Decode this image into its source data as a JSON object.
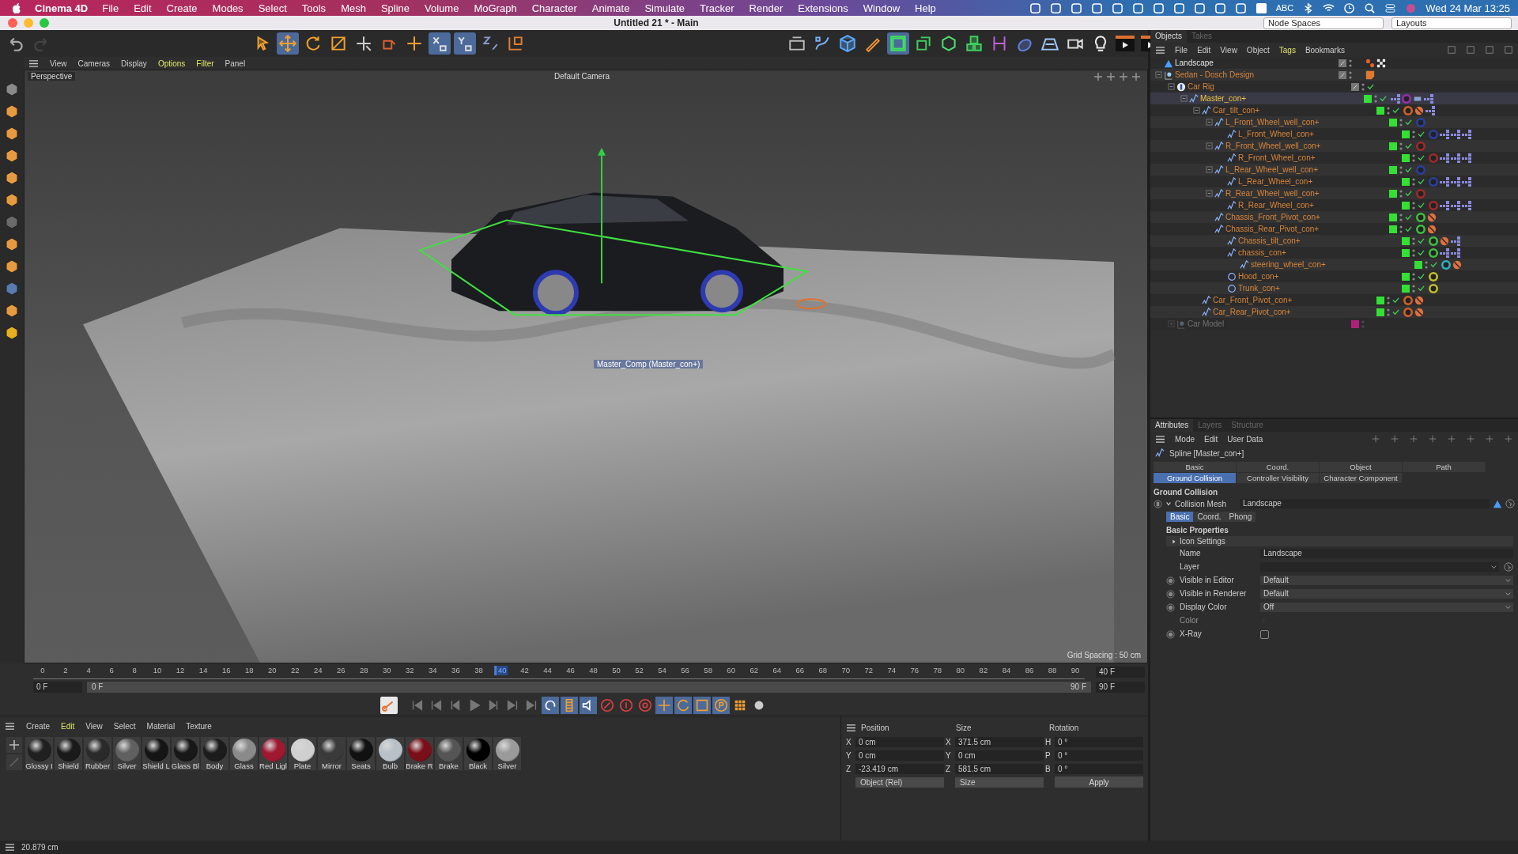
{
  "menubar": {
    "app": "Cinema 4D",
    "items": [
      "File",
      "Edit",
      "Create",
      "Modes",
      "Select",
      "Tools",
      "Mesh",
      "Spline",
      "Volume",
      "MoGraph",
      "Character",
      "Animate",
      "Simulate",
      "Tracker",
      "Render",
      "Extensions",
      "Window",
      "Help"
    ],
    "input_source": "ABC",
    "clock": "Wed 24 Mar  13:25"
  },
  "window": {
    "title": "Untitled 21 * - Main",
    "node_spaces": "Node Spaces",
    "layouts": "Layouts"
  },
  "viewport": {
    "menu": [
      {
        "label": "View",
        "highlighted": false
      },
      {
        "label": "Cameras",
        "highlighted": false
      },
      {
        "label": "Display",
        "highlighted": false
      },
      {
        "label": "Options",
        "highlighted": true
      },
      {
        "label": "Filter",
        "highlighted": true
      },
      {
        "label": "Panel",
        "highlighted": false
      }
    ],
    "camera": "Perspective",
    "active_camera": "Default Camera",
    "handle_label": "Master_Comp (Master_con+)",
    "grid_spacing": "Grid Spacing : 50 cm"
  },
  "timeline": {
    "ticks": [
      "0",
      "2",
      "4",
      "6",
      "8",
      "10",
      "12",
      "14",
      "16",
      "18",
      "20",
      "22",
      "24",
      "26",
      "28",
      "30",
      "32",
      "34",
      "36",
      "38",
      "42",
      "44",
      "46",
      "48",
      "50",
      "52",
      "54",
      "56",
      "58",
      "60",
      "62",
      "64",
      "66",
      "68",
      "70",
      "72",
      "74",
      "76",
      "78",
      "80",
      "82",
      "84",
      "86",
      "88",
      "90"
    ],
    "current_label": "40",
    "level": 0.444,
    "start_field": "0 F",
    "range": {
      "start": "0 F",
      "end": "90 F",
      "level": 1
    },
    "current_field": "40 F",
    "end_field": "90 F"
  },
  "materials": {
    "menu": [
      {
        "label": "Create",
        "highlighted": false
      },
      {
        "label": "Edit",
        "highlighted": true
      },
      {
        "label": "View",
        "highlighted": false
      },
      {
        "label": "Select",
        "highlighted": false
      },
      {
        "label": "Material",
        "highlighted": false
      },
      {
        "label": "Texture",
        "highlighted": false
      }
    ],
    "items": [
      {
        "name": "Glossy I",
        "color": "#202020"
      },
      {
        "name": "Shield",
        "color": "#1a1a1a"
      },
      {
        "name": "Rubber",
        "color": "#2a2a2a"
      },
      {
        "name": "Silver",
        "color": "#606060"
      },
      {
        "name": "Shield L",
        "color": "#151515"
      },
      {
        "name": "Glass Bl",
        "color": "#181818"
      },
      {
        "name": "Body",
        "color": "#1c1c1c"
      },
      {
        "name": "Glass",
        "color": "#8a8a8a"
      },
      {
        "name": "Red Ligl",
        "color": "#a01830"
      },
      {
        "name": "Plate",
        "color": "#cfcfcf"
      },
      {
        "name": "Mirror",
        "color": "#3a3a3a"
      },
      {
        "name": "Seats",
        "color": "#111111"
      },
      {
        "name": "Bulb",
        "color": "#b8c0c8"
      },
      {
        "name": "Brake R",
        "color": "#7a0f18"
      },
      {
        "name": "Brake",
        "color": "#555555"
      },
      {
        "name": "Black",
        "color": "#000000"
      },
      {
        "name": "Silver",
        "color": "#9a9a9a"
      }
    ]
  },
  "coordinates": {
    "headers": [
      "Position",
      "Size",
      "Rotation"
    ],
    "rows": [
      {
        "pos_axis": "X",
        "position": "0 cm",
        "size_axis": "X",
        "size": "371.5 cm",
        "rot_axis": "H",
        "rotation": "0 °"
      },
      {
        "pos_axis": "Y",
        "position": "0 cm",
        "size_axis": "Y",
        "size": "0 cm",
        "rot_axis": "P",
        "rotation": "0 °"
      },
      {
        "pos_axis": "Z",
        "position": "-23.419 cm",
        "size_axis": "Z",
        "size": "581.5 cm",
        "rot_axis": "B",
        "rotation": "0 °"
      }
    ],
    "mode": "Object (Rel)",
    "size_mode": "Size",
    "apply": "Apply"
  },
  "objects": {
    "tabs": [
      {
        "label": "Objects",
        "selected": true
      },
      {
        "label": "Takes",
        "selected": false
      }
    ],
    "menu": [
      {
        "label": "File",
        "highlighted": false
      },
      {
        "label": "Edit",
        "highlighted": false
      },
      {
        "label": "View",
        "highlighted": false
      },
      {
        "label": "Object",
        "highlighted": false
      },
      {
        "label": "Tags",
        "highlighted": true
      },
      {
        "label": "Bookmarks",
        "highlighted": false
      }
    ],
    "tree": [
      {
        "name": "Landscape",
        "kind": "landscape",
        "referenced": false,
        "selected": false,
        "disabled": false,
        "checked": false,
        "tags": [
          {
            "kind": "balls",
            "color": "#e0602a"
          },
          {
            "kind": "checker",
            "color": "#eeeeee"
          }
        ]
      },
      {
        "name": "Sedan - Dosch Design",
        "kind": "xref",
        "referenced": true,
        "selected": false,
        "disabled": false,
        "checked": false,
        "expanded": true,
        "tags": [
          {
            "kind": "note",
            "color": "#e07a30"
          }
        ],
        "children": [
          {
            "name": "Car Rig",
            "kind": "character",
            "referenced": true,
            "selected": false,
            "disabled": false,
            "checked": true,
            "expanded": true,
            "children": [
              {
                "name": "Master_con+",
                "kind": "spline",
                "color": "#33e033",
                "referenced": true,
                "selected": true,
                "disabled": false,
                "checked": true,
                "expanded": true,
                "tags": [
                  {
                    "kind": "xpresso",
                    "color": "#8a8ae0"
                  },
                  {
                    "kind": "constraint",
                    "color": "#9a2fb0"
                  },
                  {
                    "kind": "python",
                    "color": "#8aa0d0"
                  },
                  {
                    "kind": "xpresso",
                    "color": "#8a8ae0"
                  }
                ],
                "children": [
                  {
                    "name": "Car_tilt_con+",
                    "kind": "spline",
                    "color": "#33e033",
                    "referenced": true,
                    "selected": false,
                    "disabled": false,
                    "checked": true,
                    "expanded": true,
                    "tags": [
                      {
                        "kind": "constraint",
                        "color": "#d0602a"
                      },
                      {
                        "kind": "protection",
                        "color": "#e07040"
                      },
                      {
                        "kind": "xpresso",
                        "color": "#8a8ae0"
                      }
                    ],
                    "children": [
                      {
                        "name": "L_Front_Wheel_well_con+",
                        "kind": "spline",
                        "color": "#33e033",
                        "referenced": true,
                        "selected": false,
                        "disabled": false,
                        "checked": true,
                        "expanded": true,
                        "tags": [
                          {
                            "kind": "constraint",
                            "color": "#2a3fa0"
                          }
                        ],
                        "children": [
                          {
                            "name": "L_Front_Wheel_con+",
                            "kind": "spline",
                            "color": "#33e033",
                            "referenced": true,
                            "selected": false,
                            "disabled": false,
                            "checked": true,
                            "tags": [
                              {
                                "kind": "constraint",
                                "color": "#2a3fa0"
                              },
                              {
                                "kind": "xpresso",
                                "color": "#8a8ae0"
                              },
                              {
                                "kind": "xpresso",
                                "color": "#8a8ae0"
                              },
                              {
                                "kind": "xpresso",
                                "color": "#8a8ae0"
                              }
                            ]
                          }
                        ]
                      },
                      {
                        "name": "R_Front_Wheel_well_con+",
                        "kind": "spline",
                        "color": "#33e033",
                        "referenced": true,
                        "selected": false,
                        "disabled": false,
                        "checked": true,
                        "expanded": true,
                        "tags": [
                          {
                            "kind": "constraint",
                            "color": "#a02a2a"
                          }
                        ],
                        "children": [
                          {
                            "name": "R_Front_Wheel_con+",
                            "kind": "spline",
                            "color": "#33e033",
                            "referenced": true,
                            "selected": false,
                            "disabled": false,
                            "checked": true,
                            "tags": [
                              {
                                "kind": "constraint",
                                "color": "#a02a2a"
                              },
                              {
                                "kind": "xpresso",
                                "color": "#8a8ae0"
                              },
                              {
                                "kind": "xpresso",
                                "color": "#8a8ae0"
                              },
                              {
                                "kind": "xpresso",
                                "color": "#8a8ae0"
                              }
                            ]
                          }
                        ]
                      },
                      {
                        "name": "L_Rear_Wheel_well_con+",
                        "kind": "spline",
                        "color": "#33e033",
                        "referenced": true,
                        "selected": false,
                        "disabled": false,
                        "checked": true,
                        "expanded": true,
                        "tags": [
                          {
                            "kind": "constraint",
                            "color": "#2a3fa0"
                          }
                        ],
                        "children": [
                          {
                            "name": "L_Rear_Wheel_con+",
                            "kind": "spline",
                            "color": "#33e033",
                            "referenced": true,
                            "selected": false,
                            "disabled": false,
                            "checked": true,
                            "tags": [
                              {
                                "kind": "constraint",
                                "color": "#2a3fa0"
                              },
                              {
                                "kind": "xpresso",
                                "color": "#8a8ae0"
                              },
                              {
                                "kind": "xpresso",
                                "color": "#8a8ae0"
                              },
                              {
                                "kind": "xpresso",
                                "color": "#8a8ae0"
                              }
                            ]
                          }
                        ]
                      },
                      {
                        "name": "R_Rear_Wheel_well_con+",
                        "kind": "spline",
                        "color": "#33e033",
                        "referenced": true,
                        "selected": false,
                        "disabled": false,
                        "checked": true,
                        "expanded": true,
                        "tags": [
                          {
                            "kind": "constraint",
                            "color": "#a02a2a"
                          }
                        ],
                        "children": [
                          {
                            "name": "R_Rear_Wheel_con+",
                            "kind": "spline",
                            "color": "#33e033",
                            "referenced": true,
                            "selected": false,
                            "disabled": false,
                            "checked": true,
                            "tags": [
                              {
                                "kind": "constraint",
                                "color": "#a02a2a"
                              },
                              {
                                "kind": "xpresso",
                                "color": "#8a8ae0"
                              },
                              {
                                "kind": "xpresso",
                                "color": "#8a8ae0"
                              },
                              {
                                "kind": "xpresso",
                                "color": "#8a8ae0"
                              }
                            ]
                          }
                        ]
                      },
                      {
                        "name": "Chassis_Front_Pivot_con+",
                        "kind": "spline",
                        "color": "#33e033",
                        "referenced": true,
                        "selected": false,
                        "disabled": false,
                        "checked": true,
                        "tags": [
                          {
                            "kind": "constraint",
                            "color": "#3fc03f"
                          },
                          {
                            "kind": "protection",
                            "color": "#e07040"
                          }
                        ]
                      },
                      {
                        "name": "Chassis_Rear_Pivot_con+",
                        "kind": "spline",
                        "color": "#33e033",
                        "referenced": true,
                        "selected": false,
                        "disabled": false,
                        "checked": true,
                        "tags": [
                          {
                            "kind": "constraint",
                            "color": "#3fc03f"
                          },
                          {
                            "kind": "protection",
                            "color": "#e07040"
                          }
                        ],
                        "children": [
                          {
                            "name": "Chassis_tilt_con+",
                            "kind": "spline",
                            "color": "#33e033",
                            "referenced": true,
                            "selected": false,
                            "disabled": false,
                            "checked": true,
                            "tags": [
                              {
                                "kind": "constraint",
                                "color": "#3fc03f"
                              },
                              {
                                "kind": "protection",
                                "color": "#e07040"
                              },
                              {
                                "kind": "xpresso",
                                "color": "#8a8ae0"
                              }
                            ]
                          },
                          {
                            "name": "chassis_con+",
                            "kind": "spline",
                            "color": "#33e033",
                            "referenced": true,
                            "selected": false,
                            "disabled": false,
                            "checked": true,
                            "tags": [
                              {
                                "kind": "constraint",
                                "color": "#3fc03f"
                              },
                              {
                                "kind": "xpresso",
                                "color": "#8a8ae0"
                              },
                              {
                                "kind": "xpresso",
                                "color": "#8a8ae0"
                              }
                            ],
                            "children": [
                              {
                                "name": "steering_wheel_con+",
                                "kind": "spline",
                                "color": "#33e033",
                                "referenced": true,
                                "selected": false,
                                "disabled": false,
                                "checked": true,
                                "tags": [
                                  {
                                    "kind": "constraint",
                                    "color": "#2fb0c0"
                                  },
                                  {
                                    "kind": "protection",
                                    "color": "#e07040"
                                  }
                                ]
                              }
                            ]
                          },
                          {
                            "name": "Hood_con+",
                            "kind": "circle",
                            "color": "#33e033",
                            "referenced": true,
                            "selected": false,
                            "disabled": false,
                            "checked": true,
                            "tags": [
                              {
                                "kind": "constraint",
                                "color": "#c0c02a"
                              }
                            ]
                          },
                          {
                            "name": "Trunk_con+",
                            "kind": "circle",
                            "color": "#33e033",
                            "referenced": true,
                            "selected": false,
                            "disabled": false,
                            "checked": true,
                            "tags": [
                              {
                                "kind": "constraint",
                                "color": "#c0c02a"
                              }
                            ]
                          }
                        ]
                      }
                    ]
                  },
                  {
                    "name": "Car_Front_Pivot_con+",
                    "kind": "spline",
                    "color": "#33e033",
                    "referenced": true,
                    "selected": false,
                    "disabled": false,
                    "checked": true,
                    "tags": [
                      {
                        "kind": "constraint",
                        "color": "#d0602a"
                      },
                      {
                        "kind": "protection",
                        "color": "#e07040"
                      }
                    ]
                  },
                  {
                    "name": "Car_Rear_Pivot_con+",
                    "kind": "spline",
                    "color": "#33e033",
                    "referenced": true,
                    "selected": false,
                    "disabled": false,
                    "checked": true,
                    "tags": [
                      {
                        "kind": "constraint",
                        "color": "#d0602a"
                      },
                      {
                        "kind": "protection",
                        "color": "#e07040"
                      }
                    ]
                  }
                ]
              }
            ]
          },
          {
            "name": "Car Model",
            "kind": "xref",
            "color": "#b0207a",
            "referenced": false,
            "selected": false,
            "disabled": true,
            "checked": false,
            "expanded": false
          }
        ]
      }
    ]
  },
  "attributes": {
    "tabs": [
      {
        "label": "Attributes",
        "selected": true
      },
      {
        "label": "Layers",
        "selected": false
      },
      {
        "label": "Structure",
        "selected": false
      }
    ],
    "menu": [
      "Mode",
      "Edit",
      "User Data"
    ],
    "object": "Spline [Master_con+]",
    "pages": [
      {
        "label": "Basic",
        "selected": false
      },
      {
        "label": "Coord.",
        "selected": false
      },
      {
        "label": "Object",
        "selected": false
      },
      {
        "label": "Path",
        "selected": false
      },
      {
        "label": "Ground Collision",
        "selected": true
      },
      {
        "label": "Controller Visibility",
        "selected": false
      },
      {
        "label": "Character Component",
        "selected": false
      }
    ],
    "section": "Ground Collision",
    "link": {
      "label": "Collision Mesh",
      "value": "Landscape",
      "expanded": true
    },
    "subtabs": [
      {
        "label": "Basic",
        "selected": true
      },
      {
        "label": "Coord.",
        "selected": false
      },
      {
        "label": "Phong",
        "selected": false
      }
    ],
    "group": "Basic Properties",
    "subgroup": {
      "label": "Icon Settings",
      "expanded": false
    },
    "fields": [
      {
        "kind": "text",
        "label": "Name",
        "value": "Landscape"
      },
      {
        "kind": "link",
        "label": "Layer"
      },
      {
        "kind": "select",
        "label": "Visible in Editor",
        "value": "Default"
      },
      {
        "kind": "select",
        "label": "Visible in Renderer",
        "value": "Default"
      },
      {
        "kind": "select",
        "label": "Display Color",
        "value": "Off"
      },
      {
        "kind": "color",
        "label": "Color",
        "disabled": true
      },
      {
        "kind": "checkbox",
        "label": "X-Ray",
        "checked": false
      }
    ]
  },
  "status_bar": "20.879 cm"
}
